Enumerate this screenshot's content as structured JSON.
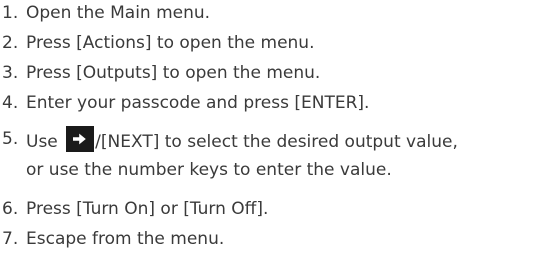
{
  "steps": [
    {
      "number": "1.",
      "text": "Open the Main menu."
    },
    {
      "number": "2.",
      "text": "Press [Actions] to open the menu."
    },
    {
      "number": "3.",
      "text": "Press [Outputs] to open the menu."
    },
    {
      "number": "4.",
      "text": "Enter your passcode and press [ENTER]."
    },
    {
      "number": "5.",
      "text_before_icon": "Use",
      "icon": "right-arrow-icon",
      "text_after_icon": "/[NEXT] to select the desired output value,",
      "text_line2": "or use the number keys to enter the value."
    },
    {
      "number": "6.",
      "text": "Press [Turn On] or [Turn Off]."
    },
    {
      "number": "7.",
      "text": "Escape from the menu."
    }
  ]
}
